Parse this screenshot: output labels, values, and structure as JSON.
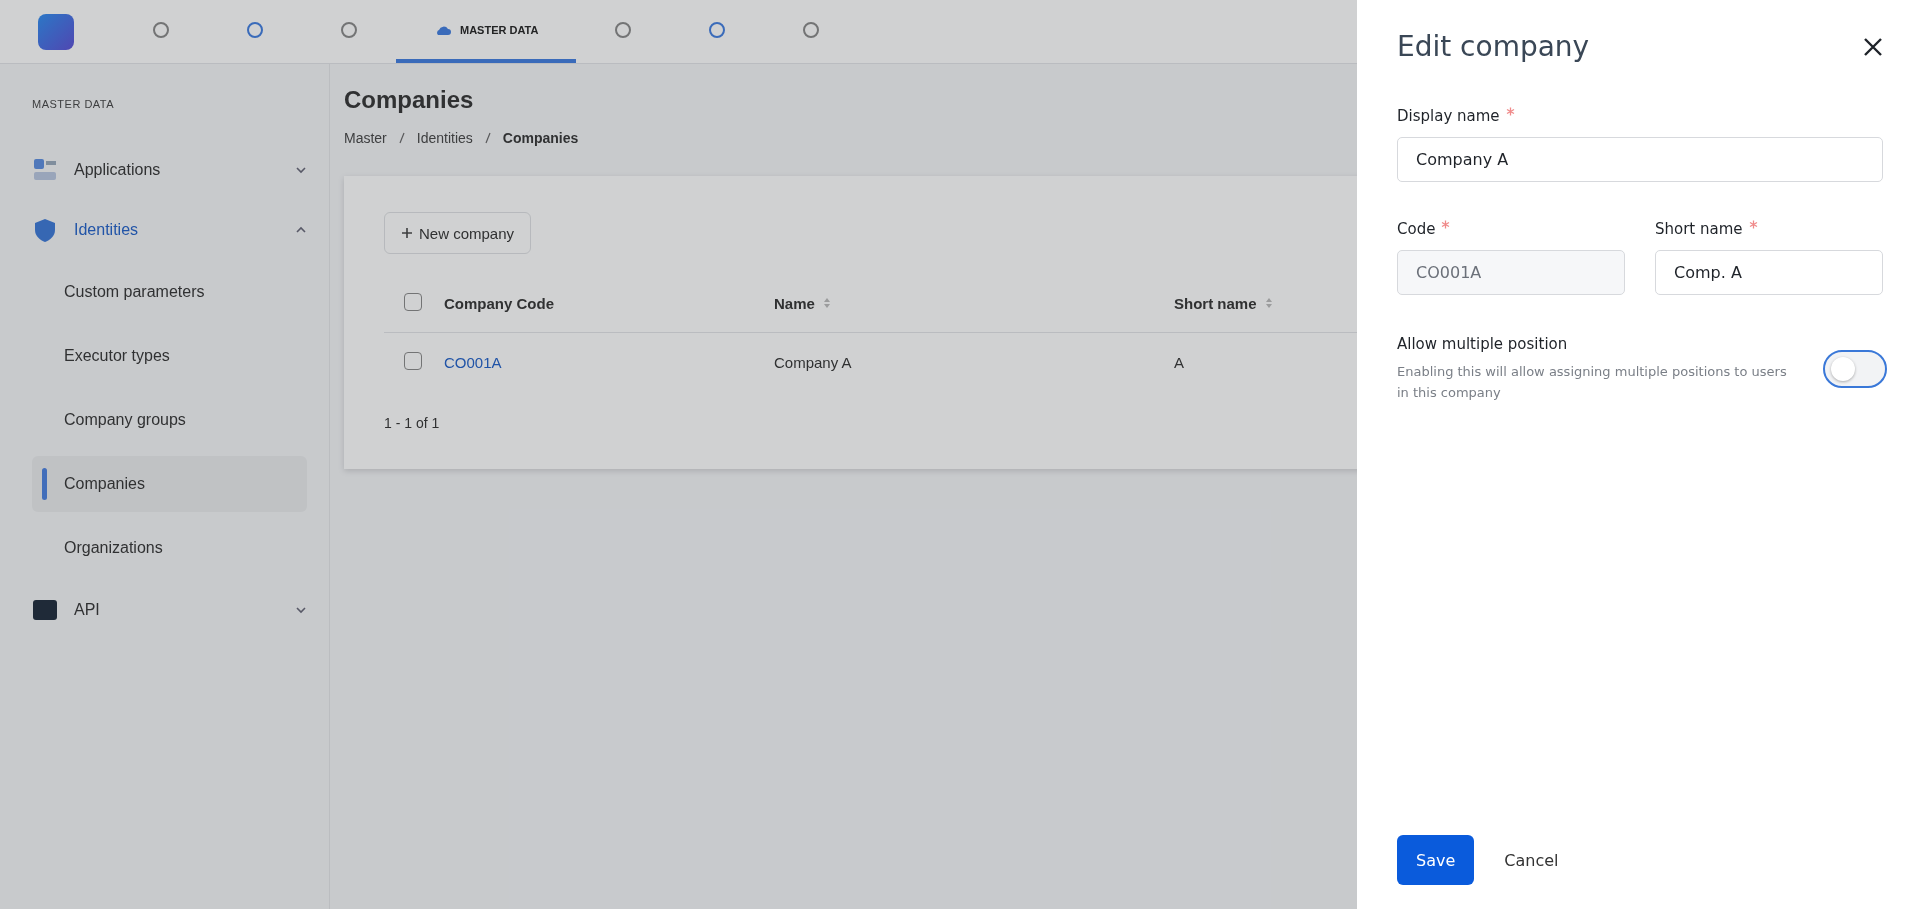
{
  "top_nav": {
    "tabs": [
      {
        "selected": false
      },
      {
        "selected": false
      },
      {
        "selected": false
      },
      {
        "label": "MASTER DATA",
        "selected": true
      },
      {
        "selected": false
      },
      {
        "selected": false
      },
      {
        "selected": false
      }
    ]
  },
  "sidebar": {
    "heading": "MASTER DATA",
    "items": [
      {
        "label": "Applications",
        "expanded": false
      },
      {
        "label": "Identities",
        "expanded": true,
        "children": [
          {
            "label": "Custom parameters",
            "selected": false
          },
          {
            "label": "Executor types",
            "selected": false
          },
          {
            "label": "Company groups",
            "selected": false
          },
          {
            "label": "Companies",
            "selected": true
          },
          {
            "label": "Organizations",
            "selected": false
          }
        ]
      },
      {
        "label": "API",
        "expanded": false
      }
    ]
  },
  "main": {
    "title": "Companies",
    "breadcrumb": [
      "Master",
      "Identities",
      "Companies"
    ],
    "new_button": "New company",
    "table": {
      "header_checked": false,
      "columns": [
        {
          "label": "Company Code",
          "sortable": false
        },
        {
          "label": "Name",
          "sortable": true
        },
        {
          "label": "Short name",
          "sortable": true
        }
      ],
      "rows": [
        {
          "checked": false,
          "cells": [
            "CO001A",
            "Company A",
            "A"
          ]
        }
      ]
    },
    "pagination": "1 - 1 of 1"
  },
  "drawer": {
    "title": "Edit company",
    "fields": [
      {
        "label": "Display name",
        "required": true,
        "value": "Company A",
        "disabled": false
      },
      {
        "label": "Code",
        "required": true,
        "value": "CO001A",
        "disabled": true
      },
      {
        "label": "Short name",
        "required": true,
        "value": "Comp. A",
        "disabled": false
      }
    ],
    "toggle": {
      "label": "Allow multiple position",
      "description": "Enabling this will allow assigning multiple positions to users in this company",
      "on": false
    },
    "save": "Save",
    "cancel": "Cancel"
  }
}
